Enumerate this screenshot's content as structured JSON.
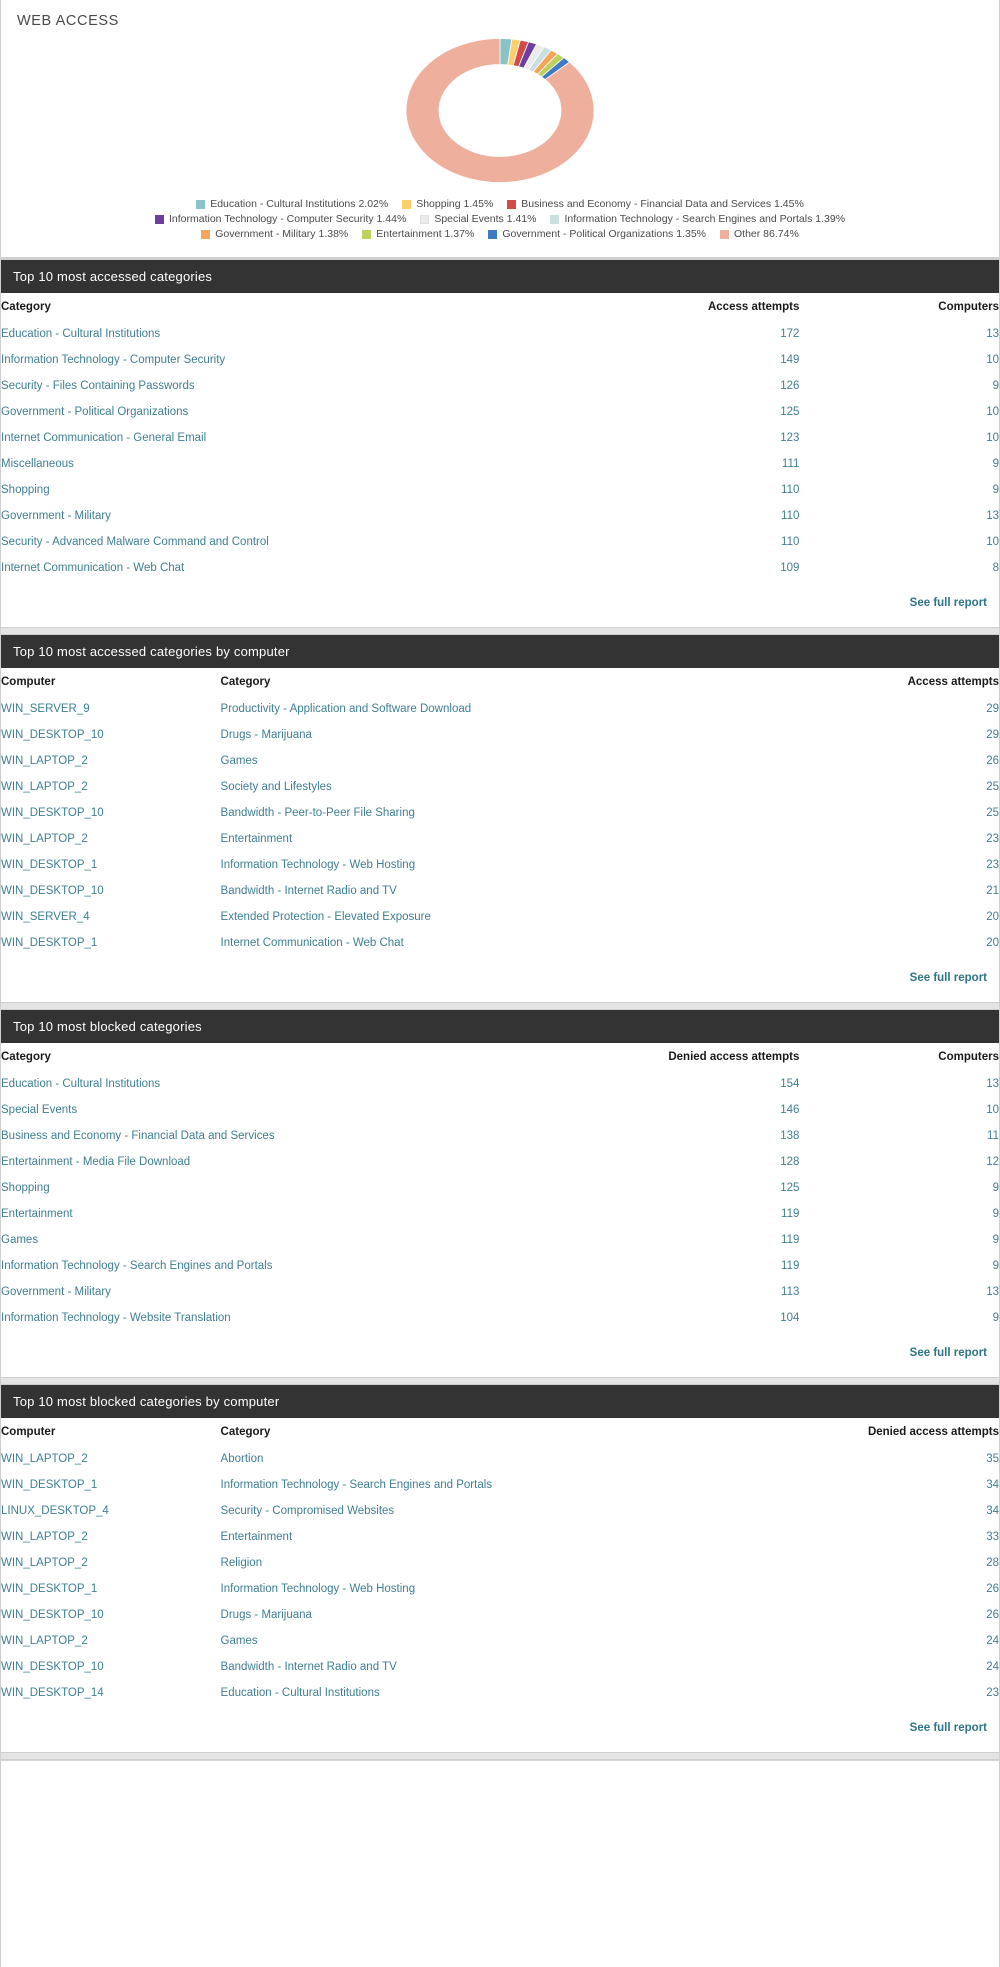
{
  "panel": {
    "title": "WEB ACCESS"
  },
  "chart_data": {
    "type": "pie",
    "variant": "donut",
    "title": "WEB ACCESS",
    "legend_position": "bottom",
    "labels": [
      "Education - Cultural Institutions",
      "Shopping",
      "Business and Economy - Financial Data and Services",
      "Information Technology - Computer Security",
      "Special Events",
      "Information Technology - Search Engines and Portals",
      "Government - Military",
      "Entertainment",
      "Government - Political Organizations",
      "Other"
    ],
    "values": [
      2.02,
      1.45,
      1.45,
      1.44,
      1.41,
      1.39,
      1.38,
      1.37,
      1.35,
      86.74
    ],
    "value_unit": "%",
    "colors": [
      "#8cc3c9",
      "#fccf6b",
      "#d14b4b",
      "#6b3f9e",
      "#ebebeb",
      "#c9dfe0",
      "#f5a45a",
      "#bdd25a",
      "#3f7bc4",
      "#eeb09c"
    ],
    "legend_rows": [
      [
        {
          "label": "Education - Cultural Institutions 2.02%",
          "color": "#8cc3c9"
        },
        {
          "label": "Shopping 1.45%",
          "color": "#fccf6b"
        },
        {
          "label": "Business and Economy - Financial Data and Services 1.45%",
          "color": "#d14b4b"
        }
      ],
      [
        {
          "label": "Information Technology - Computer Security 1.44%",
          "color": "#6b3f9e"
        },
        {
          "label": "Special Events 1.41%",
          "color": "#ebebeb"
        },
        {
          "label": "Information Technology - Search Engines and Portals 1.39%",
          "color": "#c9dfe0"
        }
      ],
      [
        {
          "label": "Government - Military 1.38%",
          "color": "#f5a45a"
        },
        {
          "label": "Entertainment 1.37%",
          "color": "#bdd25a"
        },
        {
          "label": "Government - Political Organizations 1.35%",
          "color": "#3f7bc4"
        },
        {
          "label": "Other 86.74%",
          "color": "#eeb09c"
        }
      ]
    ]
  },
  "sections": [
    {
      "id": "top-accessed-categories",
      "header": "Top 10 most accessed categories",
      "columns": [
        "Category",
        "Access attempts",
        "Computers"
      ],
      "rows": [
        [
          "Education - Cultural Institutions",
          "172",
          "13"
        ],
        [
          "Information Technology - Computer Security",
          "149",
          "10"
        ],
        [
          "Security - Files Containing Passwords",
          "126",
          "9"
        ],
        [
          "Government - Political Organizations",
          "125",
          "10"
        ],
        [
          "Internet Communication - General Email",
          "123",
          "10"
        ],
        [
          "Miscellaneous",
          "111",
          "9"
        ],
        [
          "Shopping",
          "110",
          "9"
        ],
        [
          "Government - Military",
          "110",
          "13"
        ],
        [
          "Security - Advanced Malware Command and Control",
          "110",
          "10"
        ],
        [
          "Internet Communication - Web Chat",
          "109",
          "8"
        ]
      ],
      "footer_link": "See full report"
    },
    {
      "id": "top-accessed-categories-by-computer",
      "header": "Top 10 most accessed categories by computer",
      "columns": [
        "Computer",
        "Category",
        "Access attempts"
      ],
      "rows": [
        [
          "WIN_SERVER_9",
          "Productivity - Application and Software Download",
          "29"
        ],
        [
          "WIN_DESKTOP_10",
          "Drugs - Marijuana",
          "29"
        ],
        [
          "WIN_LAPTOP_2",
          "Games",
          "26"
        ],
        [
          "WIN_LAPTOP_2",
          "Society and Lifestyles",
          "25"
        ],
        [
          "WIN_DESKTOP_10",
          "Bandwidth - Peer-to-Peer File Sharing",
          "25"
        ],
        [
          "WIN_LAPTOP_2",
          "Entertainment",
          "23"
        ],
        [
          "WIN_DESKTOP_1",
          "Information Technology - Web Hosting",
          "23"
        ],
        [
          "WIN_DESKTOP_10",
          "Bandwidth - Internet Radio and TV",
          "21"
        ],
        [
          "WIN_SERVER_4",
          "Extended Protection - Elevated Exposure",
          "20"
        ],
        [
          "WIN_DESKTOP_1",
          "Internet Communication - Web Chat",
          "20"
        ]
      ],
      "footer_link": "See full report"
    },
    {
      "id": "top-blocked-categories",
      "header": "Top 10 most blocked categories",
      "columns": [
        "Category",
        "Denied access attempts",
        "Computers"
      ],
      "rows": [
        [
          "Education - Cultural Institutions",
          "154",
          "13"
        ],
        [
          "Special Events",
          "146",
          "10"
        ],
        [
          "Business and Economy - Financial Data and Services",
          "138",
          "11"
        ],
        [
          "Entertainment - Media File Download",
          "128",
          "12"
        ],
        [
          "Shopping",
          "125",
          "9"
        ],
        [
          "Entertainment",
          "119",
          "9"
        ],
        [
          "Games",
          "119",
          "9"
        ],
        [
          "Information Technology - Search Engines and Portals",
          "119",
          "9"
        ],
        [
          "Government - Military",
          "113",
          "13"
        ],
        [
          "Information Technology - Website Translation",
          "104",
          "9"
        ]
      ],
      "footer_link": "See full report"
    },
    {
      "id": "top-blocked-categories-by-computer",
      "header": "Top 10 most blocked categories by computer",
      "columns": [
        "Computer",
        "Category",
        "Denied access attempts"
      ],
      "rows": [
        [
          "WIN_LAPTOP_2",
          "Abortion",
          "35"
        ],
        [
          "WIN_DESKTOP_1",
          "Information Technology - Search Engines and Portals",
          "34"
        ],
        [
          "LINUX_DESKTOP_4",
          "Security - Compromised Websites",
          "34"
        ],
        [
          "WIN_LAPTOP_2",
          "Entertainment",
          "33"
        ],
        [
          "WIN_LAPTOP_2",
          "Religion",
          "28"
        ],
        [
          "WIN_DESKTOP_1",
          "Information Technology - Web Hosting",
          "26"
        ],
        [
          "WIN_DESKTOP_10",
          "Drugs - Marijuana",
          "26"
        ],
        [
          "WIN_LAPTOP_2",
          "Games",
          "24"
        ],
        [
          "WIN_DESKTOP_10",
          "Bandwidth - Internet Radio and TV",
          "24"
        ],
        [
          "WIN_DESKTOP_14",
          "Education - Cultural Institutions",
          "23"
        ]
      ],
      "footer_link": "See full report"
    }
  ]
}
